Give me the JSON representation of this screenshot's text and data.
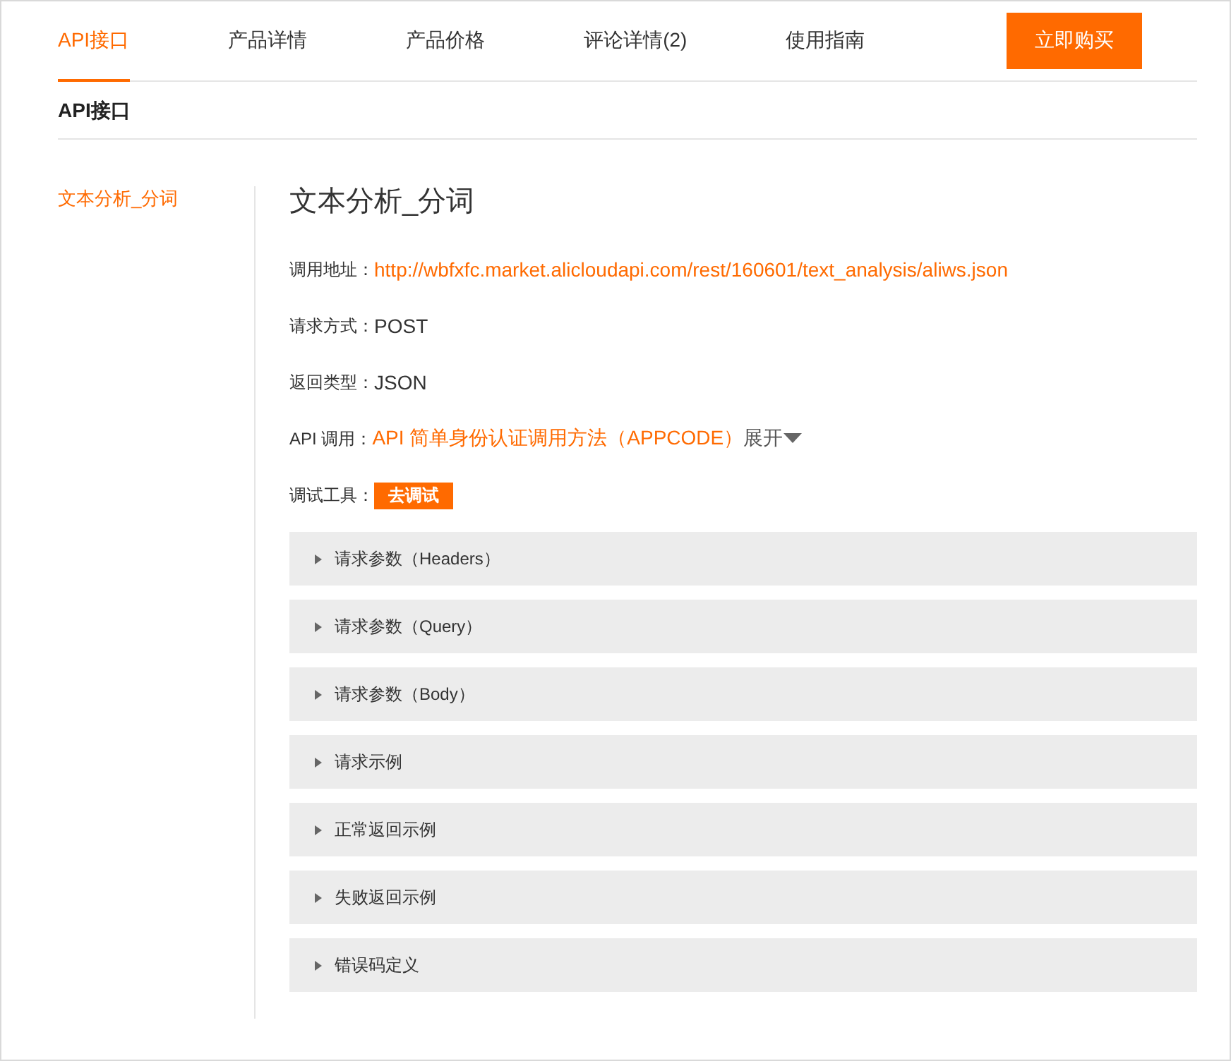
{
  "tabs": [
    {
      "label": "API接口",
      "selected": true
    },
    {
      "label": "产品详情",
      "selected": false
    },
    {
      "label": "产品价格",
      "selected": false
    },
    {
      "label": "评论详情(2)",
      "selected": false
    },
    {
      "label": "使用指南",
      "selected": false
    }
  ],
  "buy_button": "立即购买",
  "section_title": "API接口",
  "sidebar": {
    "items": [
      {
        "label": "文本分析_分词",
        "selected": true
      }
    ]
  },
  "api": {
    "title": "文本分析_分词",
    "fields": [
      {
        "kind": "link",
        "label": "调用地址：",
        "value": "http://wbfxfc.market.alicloudapi.com/rest/160601/text_analysis/aliws.json"
      },
      {
        "kind": "text",
        "label": "请求方式：",
        "value": "POST"
      },
      {
        "kind": "text",
        "label": "返回类型：",
        "value": "JSON"
      },
      {
        "kind": "expand",
        "label": "API 调用：",
        "value": "API 简单身份认证调用方法（APPCODE）",
        "toggle": "展开"
      },
      {
        "kind": "button",
        "label": "调试工具：",
        "value": "去调试"
      }
    ],
    "sections": [
      {
        "label": "请求参数（Headers）",
        "expanded": false
      },
      {
        "label": "请求参数（Query）",
        "expanded": false
      },
      {
        "label": "请求参数（Body）",
        "expanded": false
      },
      {
        "label": "请求示例",
        "expanded": false
      },
      {
        "label": "正常返回示例",
        "expanded": false
      },
      {
        "label": "失败返回示例",
        "expanded": false
      },
      {
        "label": "错误码定义",
        "expanded": false
      }
    ]
  }
}
